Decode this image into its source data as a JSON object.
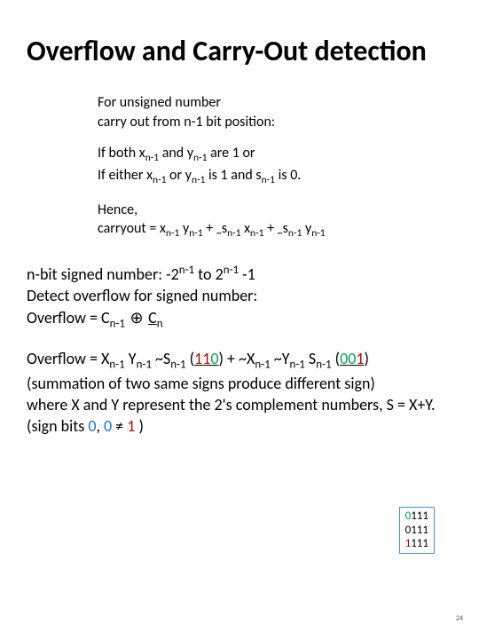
{
  "title": "Overflow and Carry-Out detection",
  "indent": {
    "p1a": "For unsigned number",
    "p1b": "carry out from n-1 bit position:",
    "p2_pre": "If both x",
    "p2_mid1": " and y",
    "p2_mid2": " are 1 or",
    "p2b_pre": "If either x",
    "p2b_mid1": " or y",
    "p2b_mid2": " is 1 and s",
    "p2b_end": " is 0.",
    "p3a": "Hence,",
    "p3b_pre": "carryout = x",
    "p3b_m1": " y",
    "p3b_m2": " + ",
    "p3b_m3": "s",
    "p3b_m4": " x",
    "p3b_m5": " + ",
    "p3b_m6": "s",
    "p3b_m7": " y",
    "sub": "n-1",
    "tilde": "~"
  },
  "body": {
    "p1_pre": "n-bit signed number: -2",
    "p1_mid": " to 2",
    "p1_end": " -1",
    "sup": "n-1",
    "p1b": "Detect overflow for signed number:",
    "p1c_pre": "Overflow = C",
    "p1c_sub1": "n-1",
    "p1c_xor": "⊕",
    "p1c_mid": "  C",
    "p1c_sub2": "n",
    "p2_pre": "Overflow = X",
    "p2_m1": " Y",
    "p2_m2": " ~S",
    "p2_m3": " (",
    "p2_110_a": "1",
    "p2_110_b": "1",
    "p2_110_c": "0",
    "p2_m4": ") + ~X",
    "p2_m5": " ~Y",
    "p2_m6": " S",
    "p2_m7": " (",
    "p2_001_a": "0",
    "p2_001_b": "0",
    "p2_001_c": "1",
    "p2_m8": ")",
    "sub": "n-1",
    "p2b": "(summation of two same signs produce different sign)",
    "p2c_pre": "where X and Y represent the 2's complement numbers, S  = X+Y.  (sign bits ",
    "p2c_z1": "0",
    "p2c_c1": ", ",
    "p2c_z2": "0",
    "p2c_ne": " ≠ ",
    "p2c_one": "1",
    "p2c_end": " )"
  },
  "box": {
    "r1a": "0",
    "r1b": "111",
    "r2a": "0",
    "r2b": "111",
    "r3a": "1",
    "r3b": "111"
  },
  "slidenum": "24"
}
